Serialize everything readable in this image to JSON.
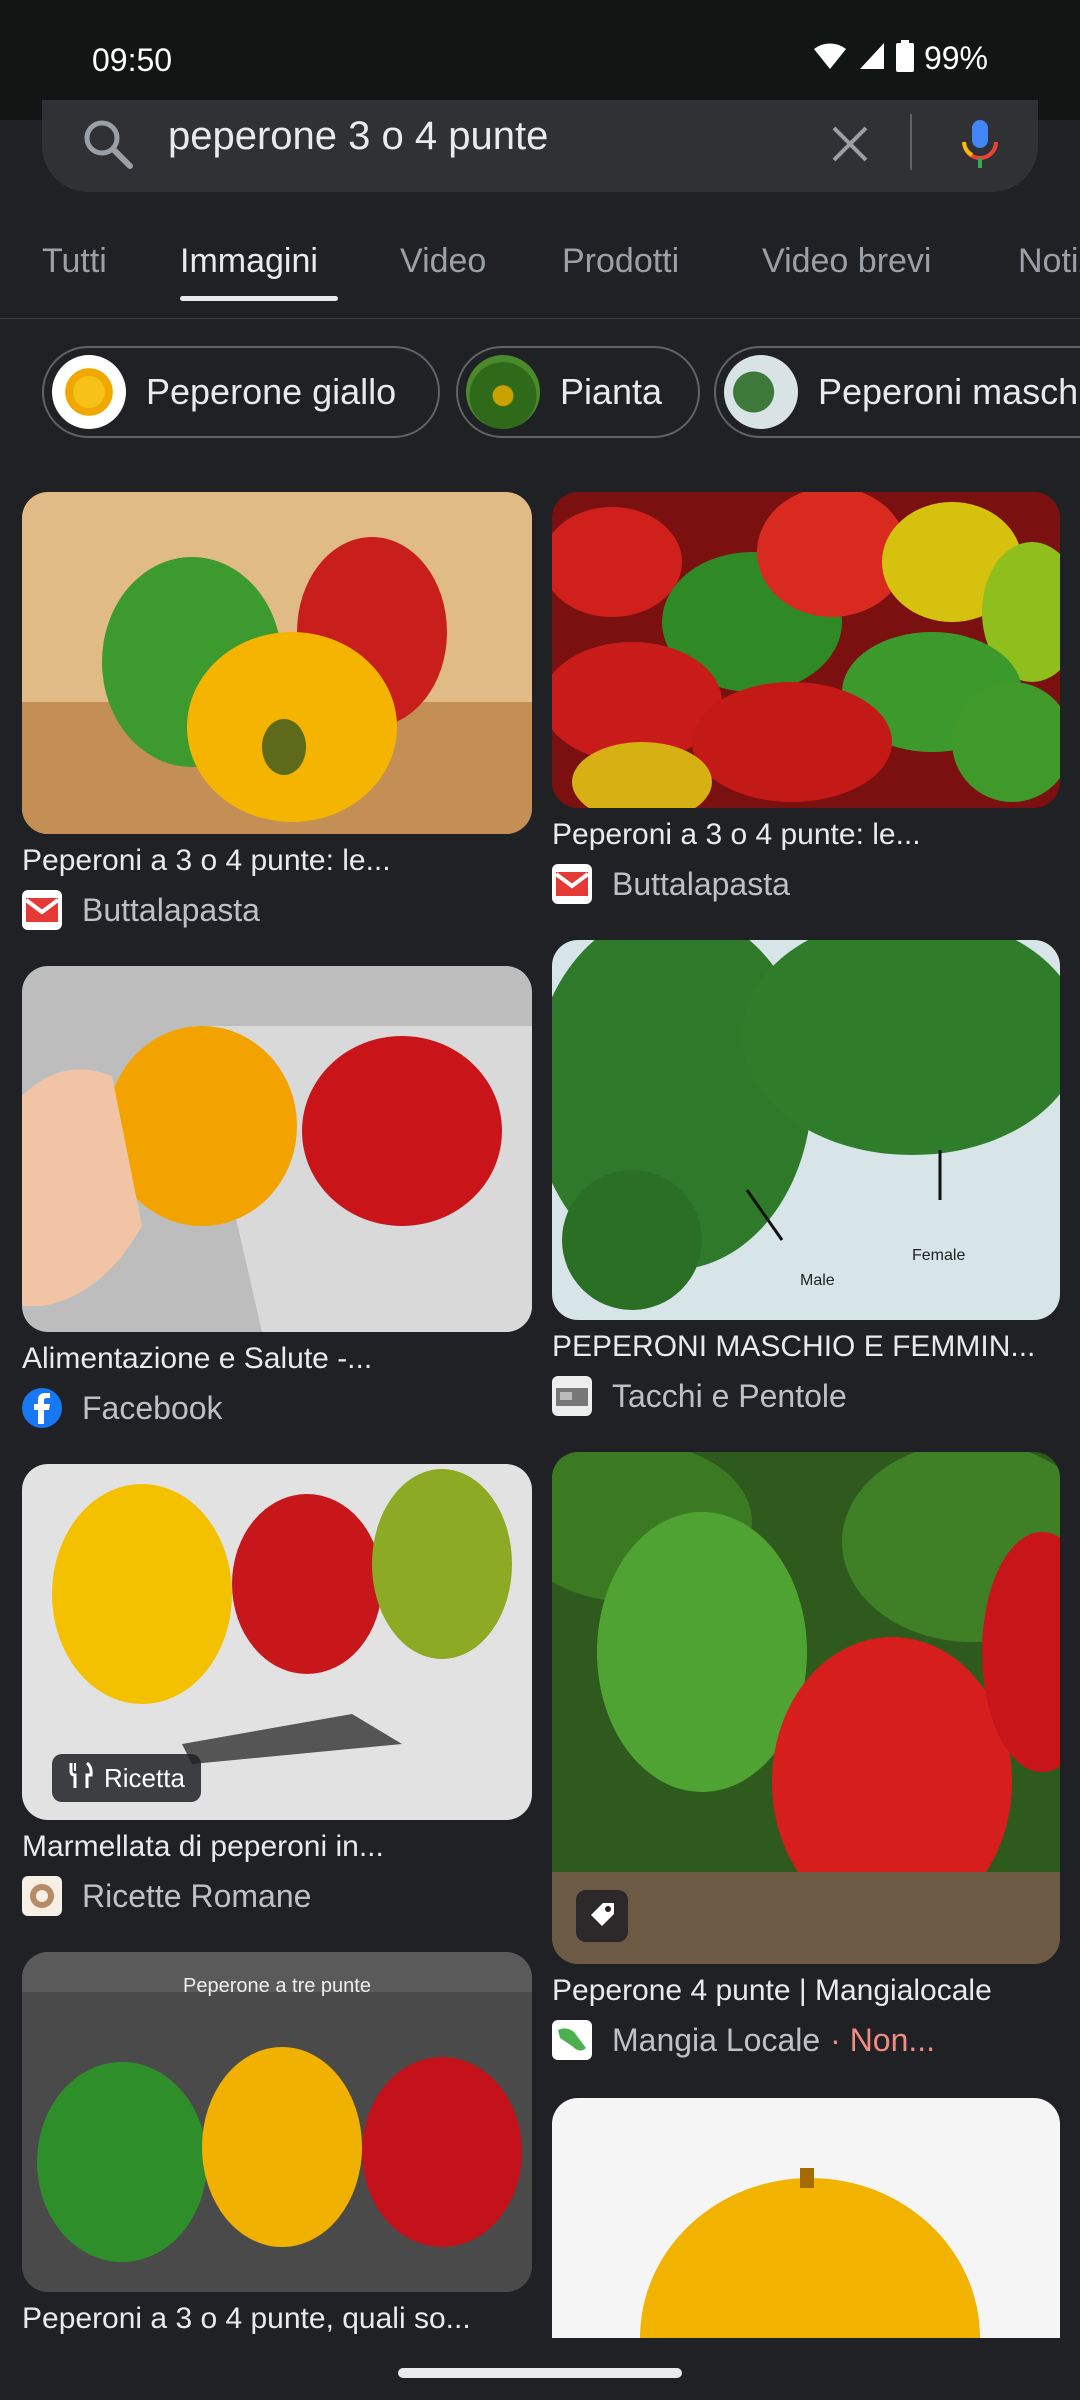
{
  "status_bar": {
    "time": "09:50",
    "battery": "99%"
  },
  "search": {
    "query": "peperone 3 o 4 punte"
  },
  "tabs": [
    {
      "label": "Tutti"
    },
    {
      "label": "Immagini"
    },
    {
      "label": "Video"
    },
    {
      "label": "Prodotti"
    },
    {
      "label": "Video brevi"
    },
    {
      "label": "Notizie"
    }
  ],
  "chips": [
    {
      "label": "Peperone giallo"
    },
    {
      "label": "Pianta"
    },
    {
      "label": "Peperoni maschio"
    }
  ],
  "results": [
    {
      "caption": "Peperoni a 3 o 4 punte: le...",
      "source": "Buttalapasta"
    },
    {
      "caption": "Peperoni a 3 o 4 punte: le...",
      "source": "Buttalapasta"
    },
    {
      "caption": "Alimentazione e Salute -...",
      "source": "Facebook"
    },
    {
      "caption": "PEPERONI MASCHIO E FEMMIN...",
      "source": "Tacchi e Pentole",
      "image_text": [
        "Male",
        "Female"
      ]
    },
    {
      "caption": "Marmellata di peperoni in...",
      "source": "Ricette Romane",
      "badge": "Ricetta"
    },
    {
      "caption": "Peperone 4 punte | Mangialocale",
      "source": "Mangia Locale",
      "source_suffix": "· Non..."
    },
    {
      "caption": "Peperoni a 3 o 4 punte, quali so...",
      "image_text": "Peperone a tre punte"
    }
  ],
  "colors": {
    "background": "#202124",
    "status_bar": "#111614",
    "search_bar": "#303134",
    "warning_text": "#f28b82"
  },
  "icons": [
    "search-icon",
    "close-icon",
    "mic-icon",
    "wifi-icon",
    "signal-icon",
    "battery-icon",
    "recipe-icon",
    "tag-icon"
  ]
}
